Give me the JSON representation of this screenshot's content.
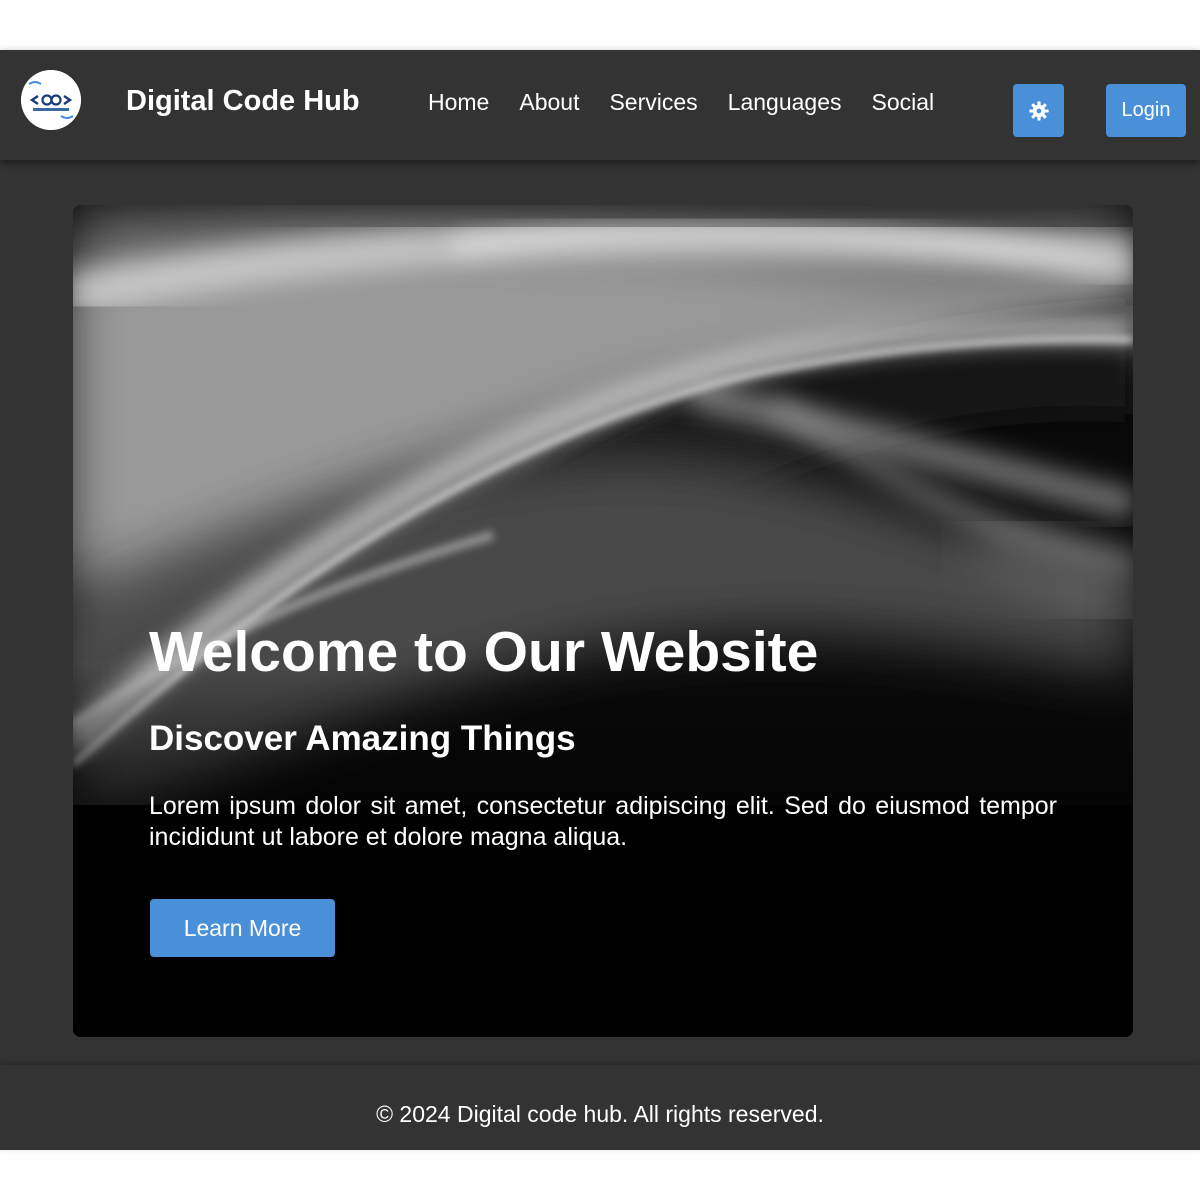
{
  "header": {
    "brand": "Digital Code Hub",
    "nav": [
      {
        "label": "Home"
      },
      {
        "label": "About"
      },
      {
        "label": "Services"
      },
      {
        "label": "Languages"
      },
      {
        "label": "Social"
      }
    ],
    "theme_toggle_icon": "gear-icon",
    "login_label": "Login"
  },
  "hero": {
    "title": "Welcome to Our Website",
    "subtitle": "Discover Amazing Things",
    "text": "Lorem ipsum dolor sit amet, consectetur adipiscing elit. Sed do eiusmod tempor incididunt ut labore et dolore magna aliqua.",
    "button_label": "Learn More"
  },
  "footer": {
    "text": "© 2024 Digital code hub. All rights reserved."
  },
  "colors": {
    "background": "#333333",
    "accent": "#4a90d9",
    "text": "#ffffff",
    "hero_bg": "#000000"
  }
}
